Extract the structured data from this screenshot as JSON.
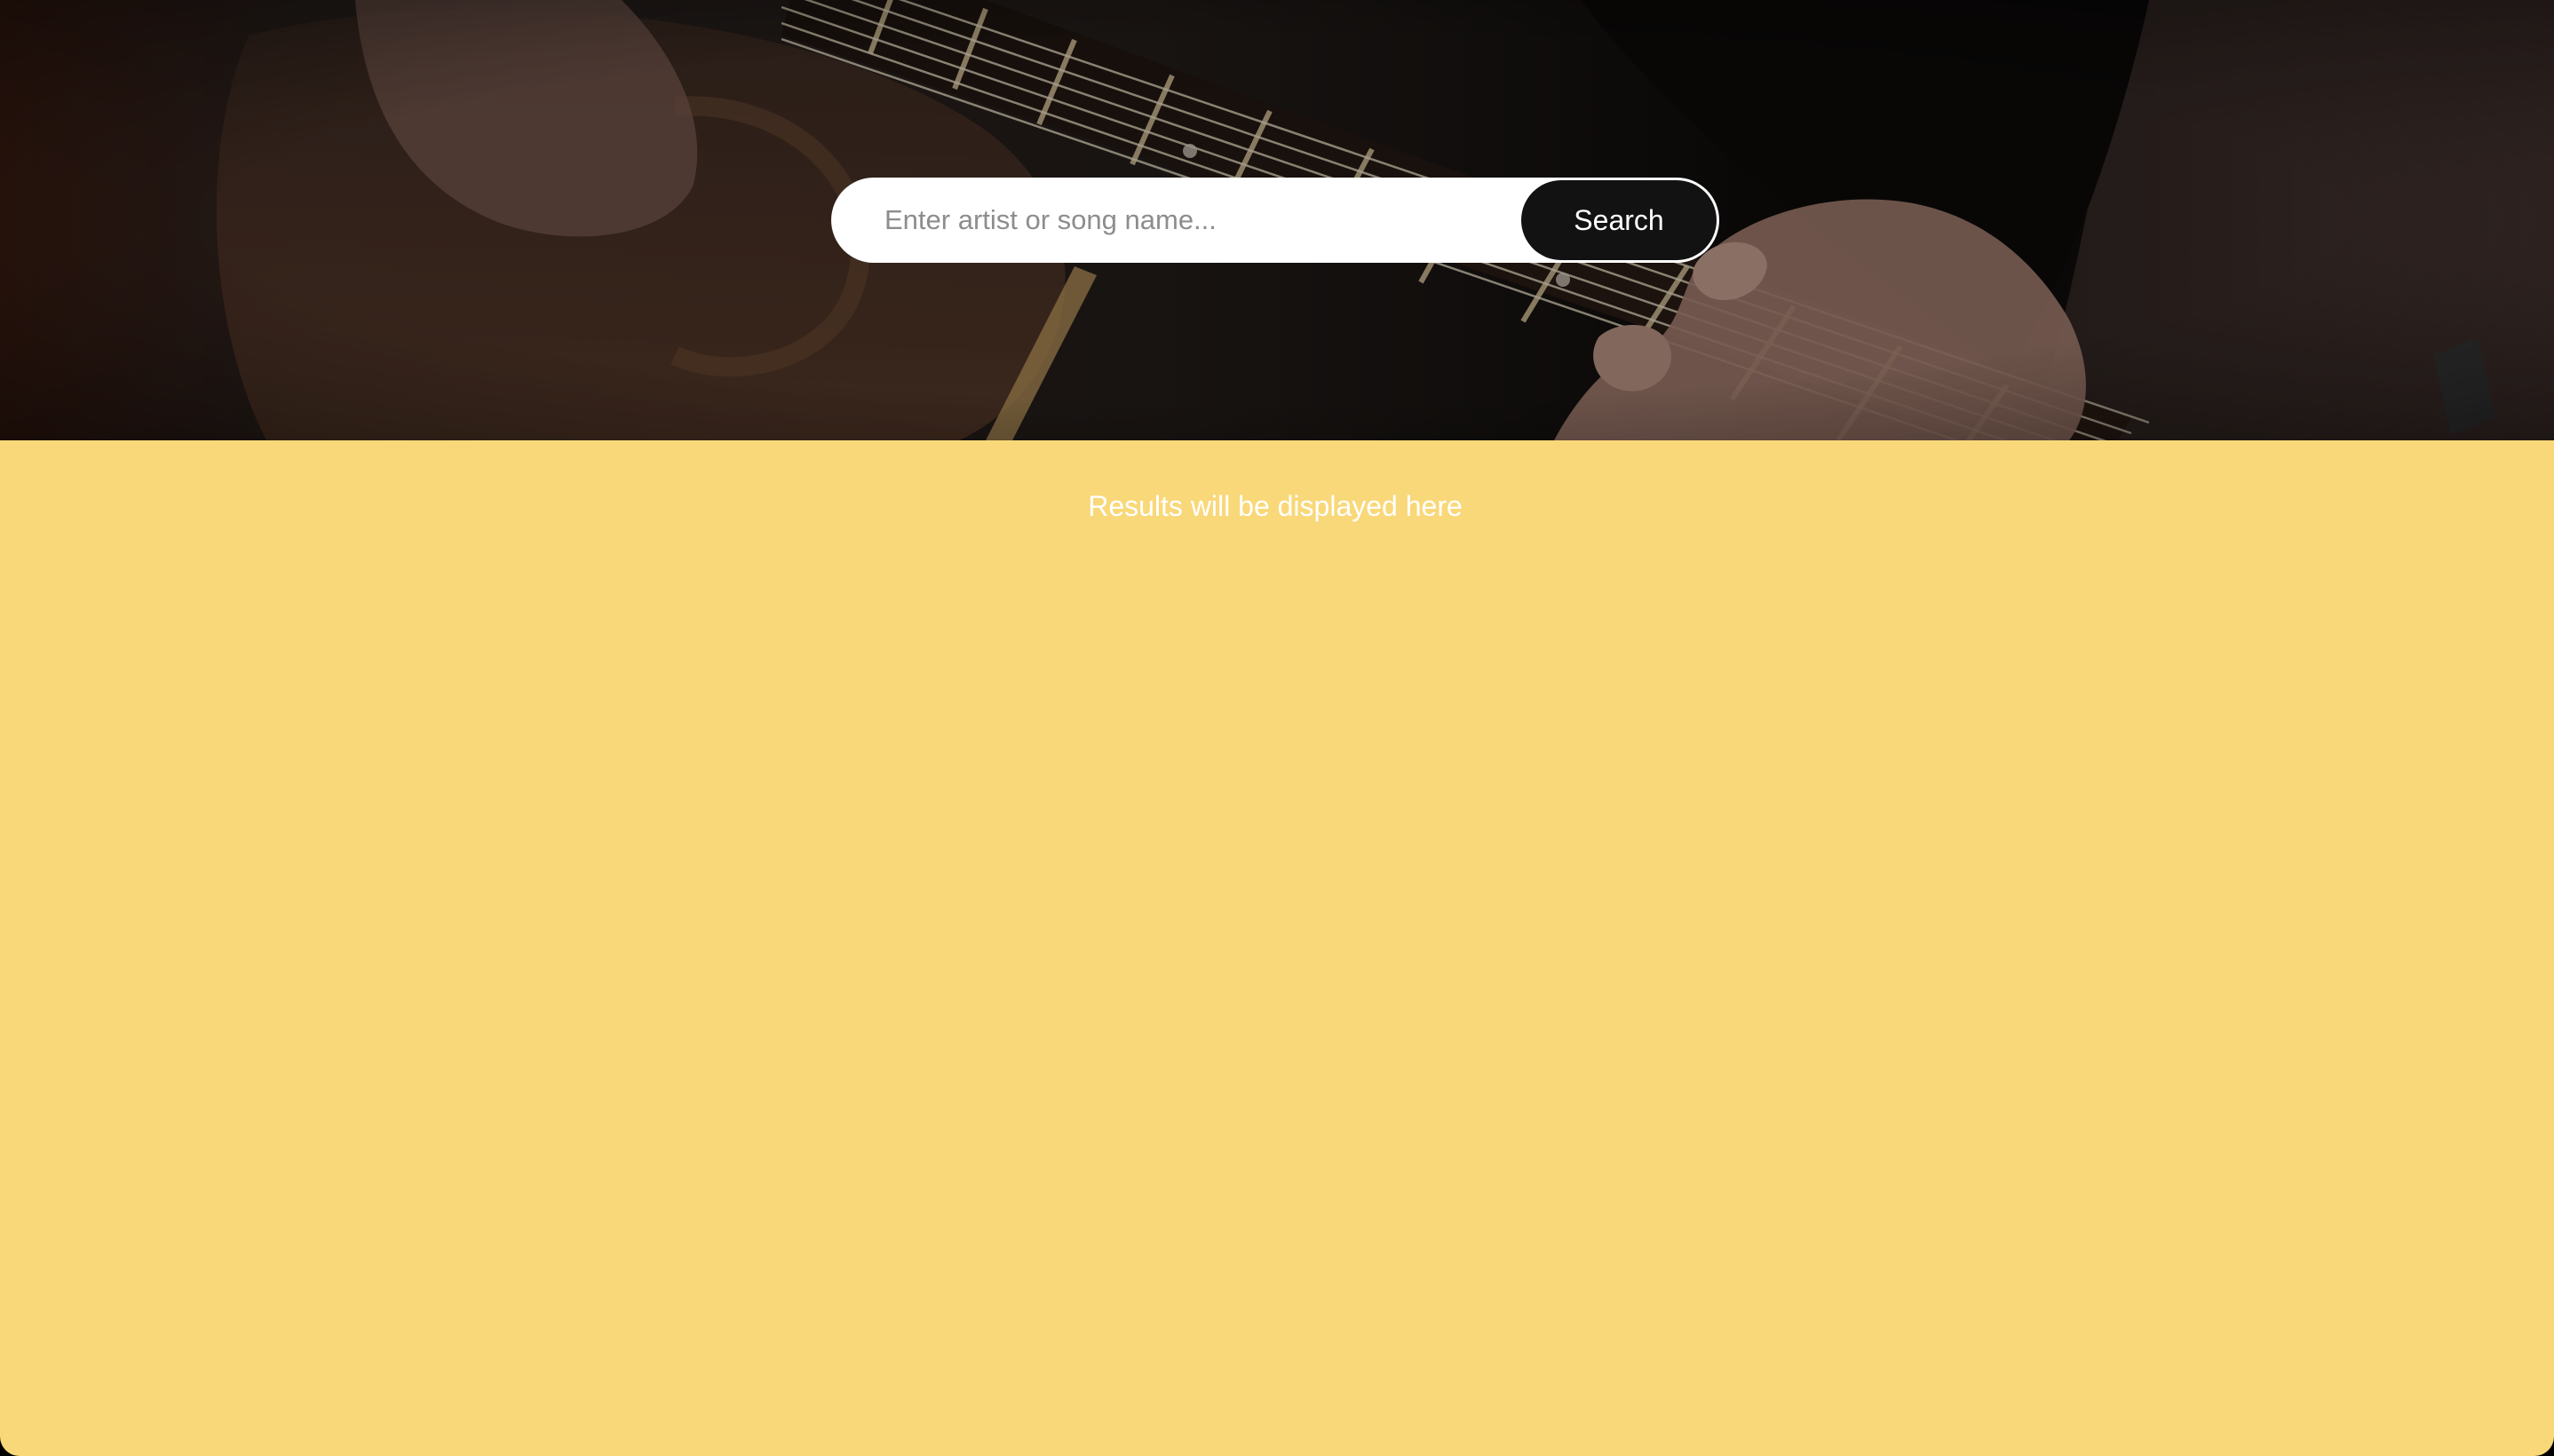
{
  "search": {
    "placeholder": "Enter artist or song name...",
    "value": "",
    "button_label": "Search"
  },
  "results": {
    "message": "Results will be displayed here"
  },
  "colors": {
    "results_background": "#f9d879",
    "button_background": "#121212",
    "input_background": "#ffffff"
  },
  "hero": {
    "image": "hero-photo-guitar"
  }
}
